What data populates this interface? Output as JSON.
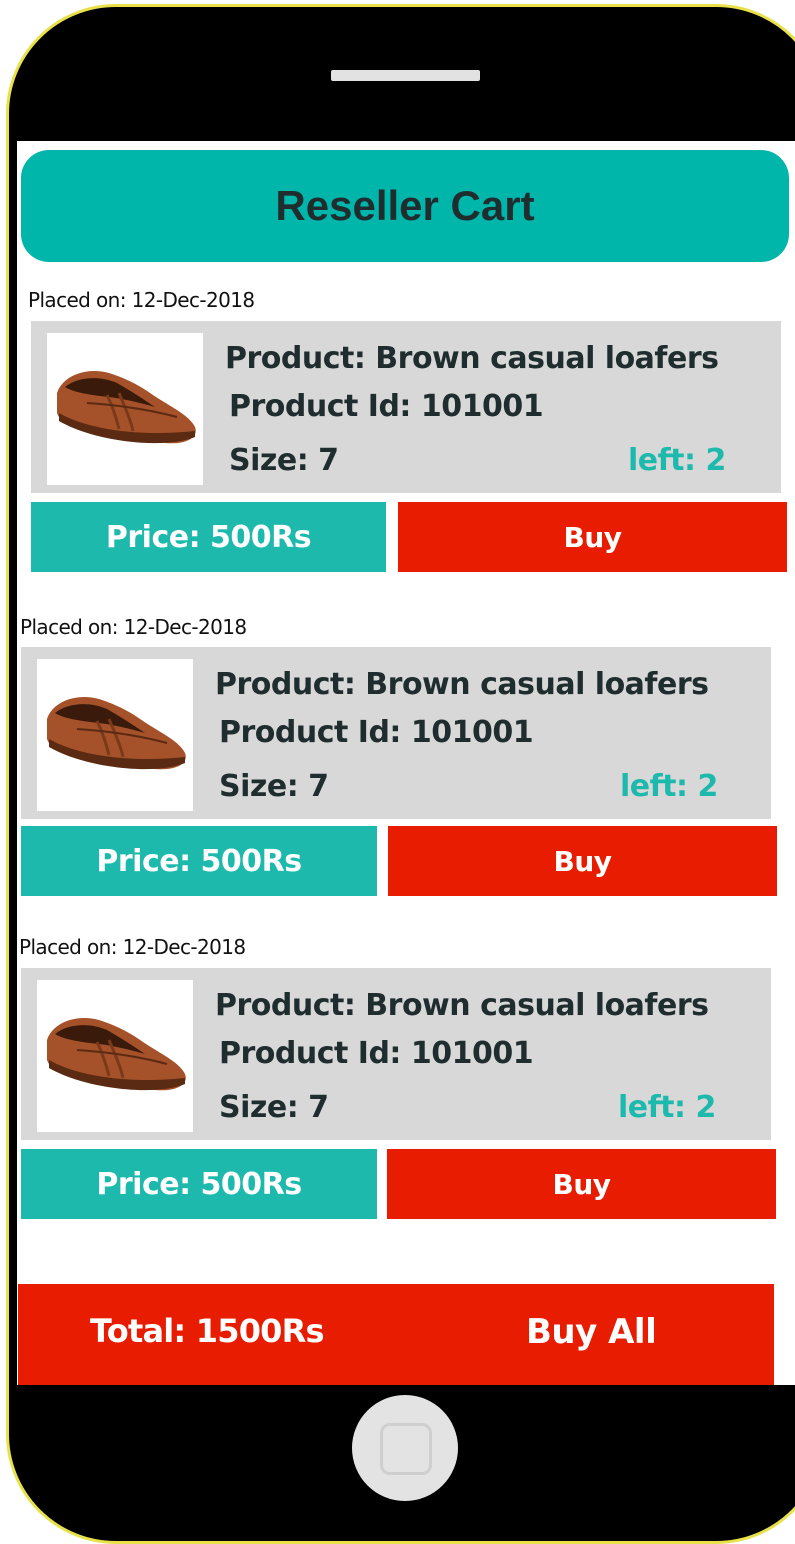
{
  "header": {
    "title": "Reseller Cart"
  },
  "orders": [
    {
      "placed": "Placed on: 12-Dec-2018",
      "product": "Product: Brown casual loafers",
      "product_id": "Product Id: 101001",
      "size": "Size: 7",
      "left": "left: 2",
      "price": "Price: 500Rs",
      "buy": "Buy"
    },
    {
      "placed": "Placed on: 12-Dec-2018",
      "product": "Product: Brown casual loafers",
      "product_id": "Product Id: 101001",
      "size": "Size: 7",
      "left": "left: 2",
      "price": "Price: 500Rs",
      "buy": "Buy"
    },
    {
      "placed": "Placed on: 12-Dec-2018",
      "product": "Product: Brown casual loafers",
      "product_id": "Product Id: 101001",
      "size": "Size: 7",
      "left": "left: 2",
      "price": "Price: 500Rs",
      "buy": "Buy"
    }
  ],
  "footer": {
    "total": "Total: 1500Rs",
    "buy_all": "Buy All"
  },
  "colors": {
    "accent": "#00b5aa",
    "buy": "#e81c00",
    "card": "#d8d8d8"
  }
}
